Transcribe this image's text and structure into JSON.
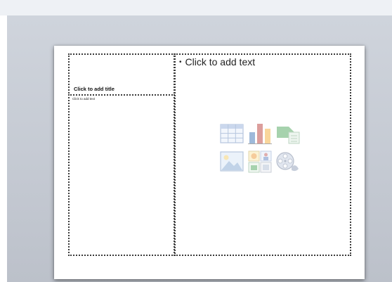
{
  "slide": {
    "title_placeholder": "Click to add title",
    "text_placeholder": "Click to add text",
    "content_placeholder": "Click to add text"
  },
  "content_icons": [
    "insert-table-icon",
    "insert-chart-icon",
    "insert-smartart-icon",
    "insert-picture-icon",
    "insert-clip-art-icon",
    "insert-media-icon"
  ]
}
